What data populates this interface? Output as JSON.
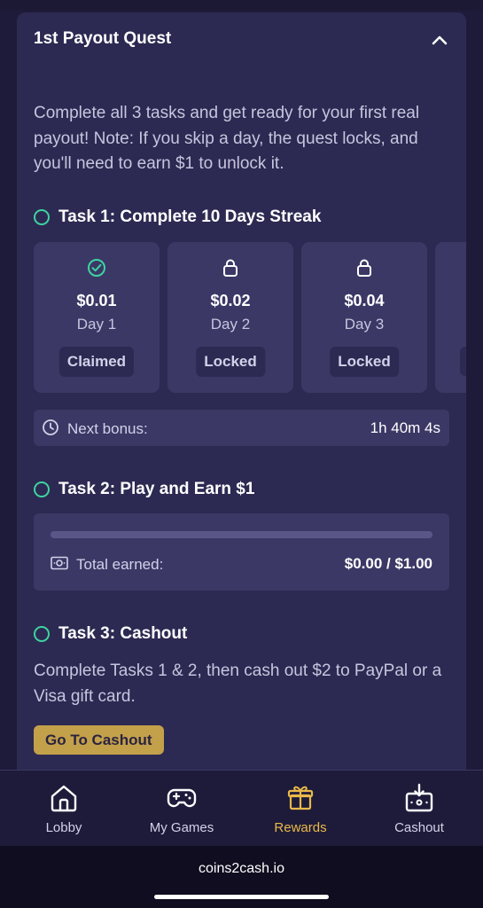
{
  "quest": {
    "title": "1st Payout Quest",
    "description": "Complete all 3 tasks and get ready for your first real payout! Note: If you skip a day, the quest locks, and you'll need to earn $1 to unlock it."
  },
  "task1": {
    "title": "Task 1: Complete 10 Days Streak",
    "days": [
      {
        "amount": "$0.01",
        "day": "Day 1",
        "status": "Claimed",
        "icon": "check-circle-icon"
      },
      {
        "amount": "$0.02",
        "day": "Day 2",
        "status": "Locked",
        "icon": "lock-icon"
      },
      {
        "amount": "$0.04",
        "day": "Day 3",
        "status": "Locked",
        "icon": "lock-icon"
      }
    ],
    "next_bonus_label": "Next bonus:",
    "next_bonus_time": "1h 40m 4s"
  },
  "task2": {
    "title": "Task 2: Play and Earn $1",
    "progress": 0,
    "total_label": "Total earned:",
    "total_value": "$0.00 / $1.00"
  },
  "task3": {
    "title": "Task 3: Cashout",
    "description": "Complete Tasks 1 & 2, then cash out $2 to PayPal or a Visa gift card.",
    "button_label": "Go To Cashout"
  },
  "nav": {
    "items": [
      {
        "label": "Lobby",
        "icon": "home-icon"
      },
      {
        "label": "My Games",
        "icon": "gamepad-icon"
      },
      {
        "label": "Rewards",
        "icon": "gift-icon",
        "active": true
      },
      {
        "label": "Cashout",
        "icon": "cashout-icon"
      }
    ]
  },
  "browser": {
    "url": "coins2cash.io"
  },
  "colors": {
    "accent_green": "#3ed3a1",
    "accent_gold": "#e9b949",
    "button_gold": "#c3a04a",
    "card_bg": "#2c2a52",
    "page_bg": "#1e1b3a"
  }
}
